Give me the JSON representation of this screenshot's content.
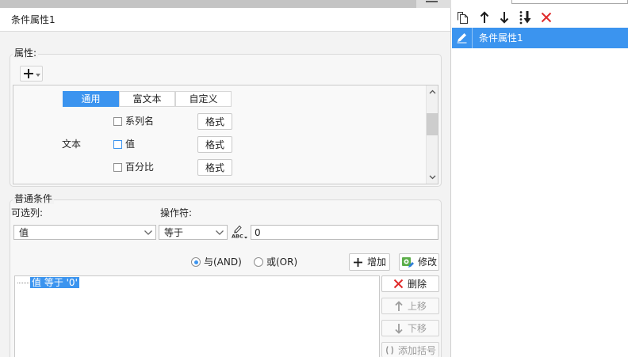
{
  "header": {
    "title": "条件属性1"
  },
  "properties": {
    "legend": "属性:",
    "add_icon": "plus-icon",
    "tabs": [
      {
        "label": "通用",
        "active": true
      },
      {
        "label": "富文本",
        "active": false
      },
      {
        "label": "自定义",
        "active": false
      }
    ],
    "group_label": "文本",
    "rows": [
      {
        "label": "系列名",
        "checked": false,
        "focused": false,
        "format_button": "格式"
      },
      {
        "label": "值",
        "checked": false,
        "focused": true,
        "format_button": "格式"
      },
      {
        "label": "百分比",
        "checked": false,
        "focused": false,
        "format_button": "格式"
      }
    ]
  },
  "condition": {
    "legend": "普通条件",
    "column_label": "可选列:",
    "column_value": "值",
    "operator_label": "操作符:",
    "operator_value": "等于",
    "formula_icon_text": "ABC",
    "value": "0",
    "logic": [
      {
        "label": "与(AND)",
        "checked": true
      },
      {
        "label": "或(OR)",
        "checked": false
      }
    ],
    "add_label": "增加",
    "modify_label": "修改",
    "items": [
      {
        "text": "值 等于 '0'",
        "selected": true
      }
    ],
    "delete_label": "删除",
    "move_up_label": "上移",
    "move_down_label": "下移",
    "add_bracket_label": "添加括号"
  },
  "attribute_list": {
    "toolbar_icons": [
      "copy-icon",
      "arrow-up-icon",
      "arrow-down-icon",
      "move-to-bottom-icon",
      "delete-icon"
    ],
    "items": [
      {
        "label": "条件属性1",
        "selected": true,
        "icon": "pencil-icon"
      }
    ]
  },
  "colors": {
    "accent": "#3b94ef",
    "danger": "#e02b2b",
    "panel_bg": "#f3f3f3",
    "disabled_text": "#9d9d9d"
  }
}
